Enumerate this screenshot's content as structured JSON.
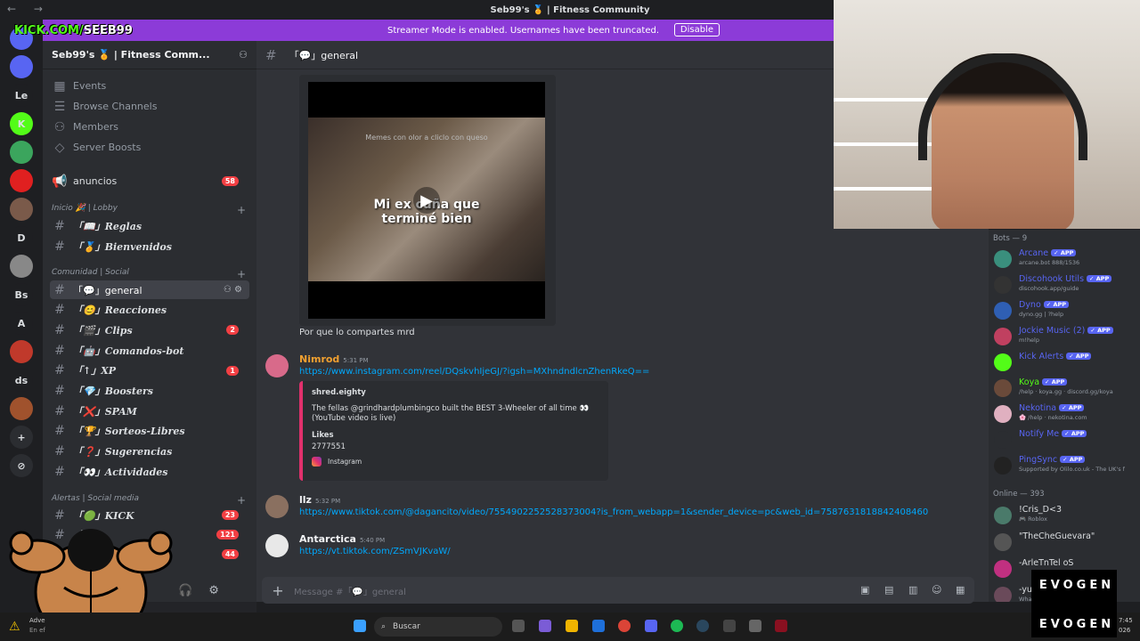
{
  "window": {
    "title": "Seb99's 🏅 | Fitness Community",
    "nav_arrows": "← →"
  },
  "overlay": {
    "kick_prefix": "KICK.COM/",
    "kick_user": "SEEB99"
  },
  "banner": {
    "message": "Streamer Mode is enabled. Usernames have been truncated.",
    "button": "Disable"
  },
  "guilds": [
    {
      "label": "",
      "badge": "17",
      "color": "#5865f2"
    },
    {
      "label": "",
      "badge": "6",
      "color": "#5865f2"
    },
    {
      "label": "Le",
      "badge": "",
      "color": "#1e1f22"
    },
    {
      "label": "K",
      "badge": "",
      "color": "#53fc18"
    },
    {
      "label": "",
      "badge": "31",
      "color": "#3ba55d"
    },
    {
      "label": "",
      "badge": "",
      "color": "#e02020"
    },
    {
      "label": "",
      "badge": "34",
      "color": "#7a5a4a"
    },
    {
      "label": "D",
      "badge": "",
      "color": "#1e1f22"
    },
    {
      "label": "",
      "badge": "11",
      "color": "#888"
    },
    {
      "label": "Bs",
      "badge": "9",
      "color": "#1e1f22"
    },
    {
      "label": "A",
      "badge": "14",
      "color": "#1e1f22"
    },
    {
      "label": "",
      "badge": "4",
      "color": "#c0392b"
    },
    {
      "label": "ds",
      "badge": "1",
      "color": "#1e1f22"
    },
    {
      "label": "",
      "badge": "250",
      "color": "#a0522d"
    },
    {
      "label": "+",
      "badge": "",
      "color": "#2b2d31"
    },
    {
      "label": "⊘",
      "badge": "",
      "color": "#2b2d31"
    }
  ],
  "sidebar": {
    "server_name": "Seb99's 🏅 | Fitness Comm...",
    "menu": [
      "Events",
      "Browse Channels",
      "Members",
      "Server Boosts"
    ],
    "announcement": {
      "label": "anuncios",
      "count": "58"
    },
    "cat_lobby": "Inicio 🎉 | Lobby",
    "lobby_channels": [
      {
        "label": "「📖」Reglas",
        "count": ""
      },
      {
        "label": "「🏅」Bienvenidos",
        "count": ""
      }
    ],
    "cat_social": "Comunidad | Social",
    "social_channels": [
      {
        "label": "「💬」general",
        "count": "",
        "selected": true
      },
      {
        "label": "「😊」Reacciones",
        "count": ""
      },
      {
        "label": "「🎬」Clips",
        "count": "2"
      },
      {
        "label": "「🤖」Comandos-bot",
        "count": ""
      },
      {
        "label": "「↑」XP",
        "count": "1"
      },
      {
        "label": "「💎」Boosters",
        "count": ""
      },
      {
        "label": "「❌」SPAM",
        "count": ""
      },
      {
        "label": "「🏆」Sorteos-Libres",
        "count": ""
      },
      {
        "label": "「❓」Sugerencias",
        "count": ""
      },
      {
        "label": "「👀」Actividades",
        "count": ""
      }
    ],
    "cat_alerts": "Alertas | Social media",
    "alert_channels": [
      {
        "label": "「🟢」KICK",
        "count": "23"
      },
      {
        "label": "「",
        "count": "121"
      },
      {
        "label": "gram",
        "count": "44"
      }
    ]
  },
  "chat": {
    "channel": "「💬」general",
    "video": {
      "watermark": "Memes con olor a cliclo con queso",
      "caption_line1": "Mi ex cuña que",
      "caption_line2": "terminé bien",
      "play": "▶"
    },
    "msg1": "Por que lo compartes mrd",
    "msg2": {
      "author": "Nimrod",
      "time": "5:31 PM",
      "link": "https://www.instagram.com/reel/DQskvhIjeGJ/?igsh=MXhndndlcnZhenRkeQ=="
    },
    "embed": {
      "title": "shred.eighty",
      "desc1": "The fellas @grindhardplumbingco built the BEST 3-Wheeler of all time 👀",
      "desc2": "(YouTube video is live)",
      "field_name": "Likes",
      "field_value": "2777551",
      "footer": "Instagram"
    },
    "msg3": {
      "author": "llz",
      "time": "5:32 PM",
      "link": "https://www.tiktok.com/@dagancito/video/7554902252528373004?is_from_webapp=1&sender_device=pc&web_id=7587631818842408460"
    },
    "msg4": {
      "author": "Antarctica",
      "time": "5:40 PM",
      "link": "https://vt.tiktok.com/ZSmVJKvaW/"
    },
    "composer_placeholder": "Message #「💬」general"
  },
  "members": {
    "bots_header": "Bots — 9",
    "bots": [
      {
        "name": "Arcane",
        "status": "arcane.bot 888/1536",
        "color": "#3a8f7d"
      },
      {
        "name": "Discohook Utils",
        "status": "discohook.app/guide",
        "color": "#333"
      },
      {
        "name": "Dyno",
        "status": "dyno.gg | ?help",
        "color": "#2f5fb3"
      },
      {
        "name": "Jockie Music (2)",
        "status": "m!help",
        "color": "#c04060"
      },
      {
        "name": "Kick Alerts",
        "status": "",
        "color": "#53fc18"
      },
      {
        "name": "Koya",
        "status": "/help · koya.gg · discord.gg/koya",
        "color": "#6a4a3a"
      },
      {
        "name": "Nekotina",
        "status": "🌸 /help · nekotina.com",
        "color": "#e0b0c0"
      },
      {
        "name": "Notify Me",
        "status": "",
        "color": "#2b2d31"
      },
      {
        "name": "PingSync",
        "status": "Supported by Olilo.co.uk - The UK's f",
        "color": "#222"
      }
    ],
    "online_header": "Online — 393",
    "online": [
      {
        "name": "!Cris_D<3",
        "status": "🎮 Roblox",
        "color": "#4a7a6a"
      },
      {
        "name": "\"TheCheGuevara\"",
        "status": "",
        "color": "#555"
      },
      {
        "name": "-ArleTnTel oS",
        "status": "",
        "color": "#c03080"
      },
      {
        "name": "-yu",
        "status": "Wha",
        "color": "#6a4a5a"
      }
    ]
  },
  "taskbar": {
    "search": "Buscar",
    "weather": "Adve",
    "weather2": "En ef",
    "time": "7:45",
    "date": "026"
  },
  "brand": {
    "line1": "EVOGEN",
    "line2": "EVOGEN"
  }
}
